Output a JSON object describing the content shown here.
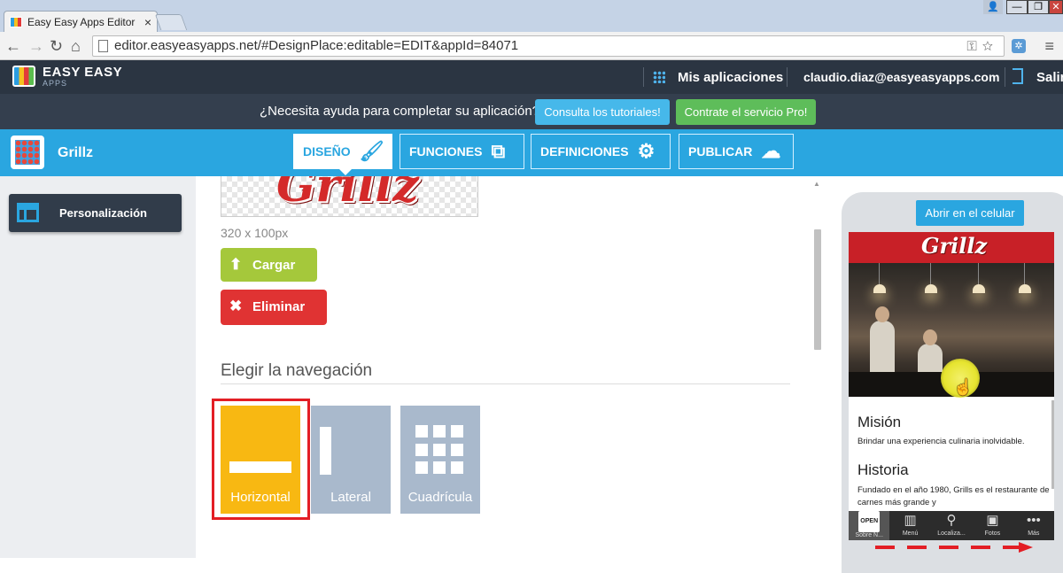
{
  "browser": {
    "tab_title": "Easy Easy Apps Editor",
    "tab_close": "×",
    "url": "editor.easyeasyapps.net/#DesignPlace:editable=EDIT&appId=84071",
    "window_buttons": [
      "—",
      "❐",
      "✕"
    ]
  },
  "app_header": {
    "logo_text": "EASY EASY",
    "logo_sub": "APPS",
    "my_apps": "Mis aplicaciones",
    "user_email": "claudio.diaz@easyeasyapps.com",
    "logout": "Salir"
  },
  "help_bar": {
    "text": "¿Necesita ayuda para completar su aplicación?",
    "tutorials_button": "Consulta los tutoriales!",
    "pro_button": "Contrate el servicio Pro!"
  },
  "toolbar": {
    "app_name": "Grillz",
    "tabs": [
      {
        "label": "DISEÑO",
        "icon": "brush-icon"
      },
      {
        "label": "FUNCIONES",
        "icon": "tags-icon"
      },
      {
        "label": "DEFINICIONES",
        "icon": "gear-icon"
      },
      {
        "label": "PUBLICAR",
        "icon": "cloud-upload-icon"
      }
    ]
  },
  "sidebar": {
    "items": [
      {
        "label": "Personalización",
        "icon": "layout-icon",
        "active": true
      }
    ]
  },
  "editor": {
    "logo_preview_text": "Grillz",
    "logo_size": "320 x 100px",
    "upload_button": "Cargar",
    "delete_button": "Eliminar",
    "navigation_heading": "Elegir la navegación",
    "navigation_options": [
      {
        "label": "Horizontal",
        "selected": true
      },
      {
        "label": "Lateral",
        "selected": false
      },
      {
        "label": "Cuadrícula",
        "selected": false
      }
    ]
  },
  "preview": {
    "open_button": "Abrir en el celular",
    "header_logo": "Grillz",
    "mission_title": "Misión",
    "mission_text": "Brindar una experiencia culinaria inolvidable.",
    "history_title": "Historia",
    "history_text": "Fundado en el año 1980, Grills es el restaurante de carnes más grande y",
    "tabbar": [
      {
        "label": "Sobre N...",
        "icon": "OPEN"
      },
      {
        "label": "Menú",
        "icon": "book-icon"
      },
      {
        "label": "Localiza...",
        "icon": "map-pin-icon"
      },
      {
        "label": "Fotos",
        "icon": "image-icon"
      },
      {
        "label": "Más",
        "icon": "more-icon"
      }
    ]
  },
  "colors": {
    "app_bar": "#2b3542",
    "help_bar": "#343f4e",
    "toolbar_blue": "#2aa6e0",
    "selected_nav": "#f8b812",
    "unselected_nav": "#a9b9cc",
    "upload_green": "#a5c83b",
    "delete_red": "#e03333",
    "highlight_red": "#e31e25"
  }
}
